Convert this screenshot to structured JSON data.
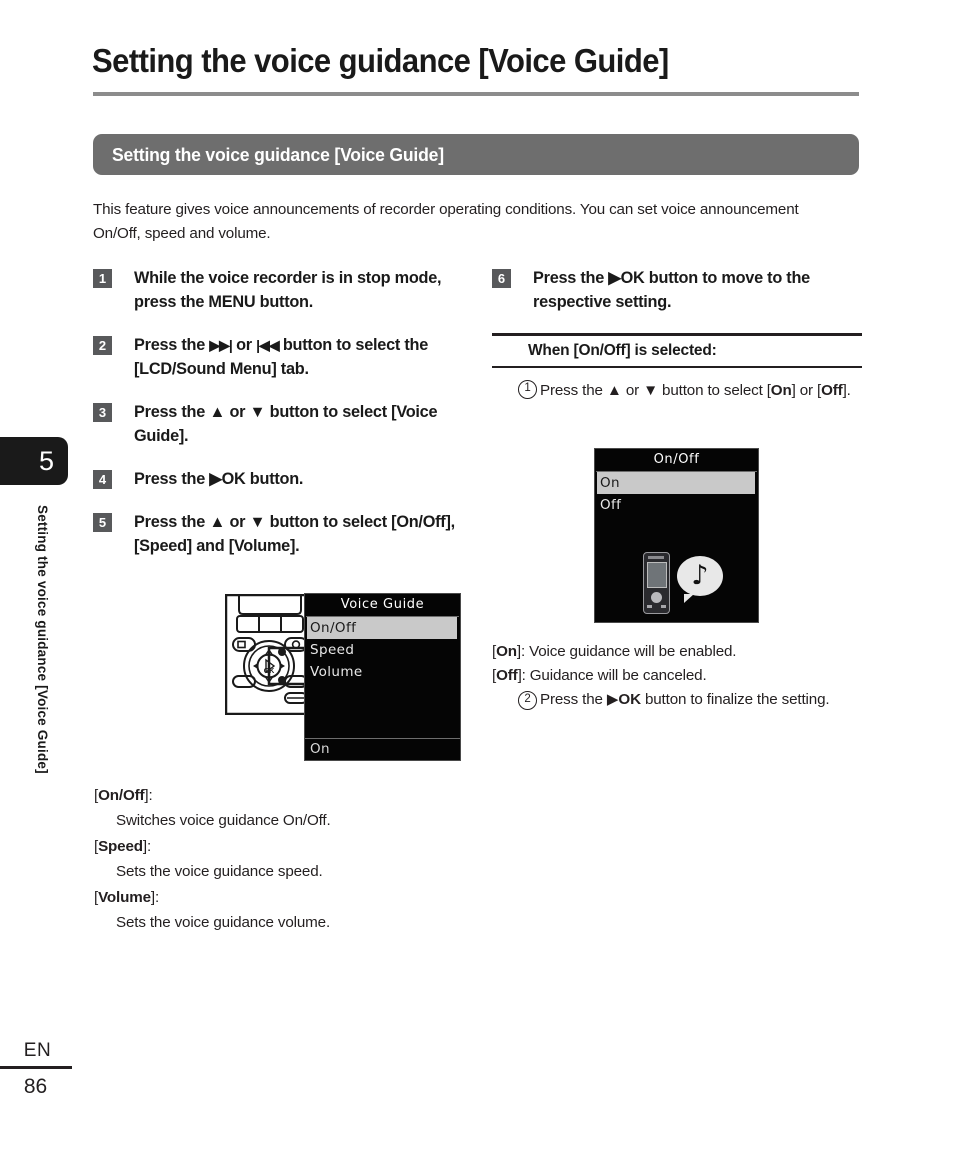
{
  "chapter": {
    "number": "5",
    "vertical_title": "Setting the voice guidance [Voice Guide]"
  },
  "footer": {
    "language": "EN",
    "page_number": "86"
  },
  "header": {
    "title": "Setting the voice guidance [Voice Guide]",
    "section_banner": "Setting the voice guidance [Voice Guide]"
  },
  "intro": "This feature gives voice announcements of recorder operating conditions. You can set voice announcement On/Off, speed and volume.",
  "steps_left": [
    {
      "num": "1",
      "text_html": "While the voice recorder is in stop mode, press the <b>MENU</b> button."
    },
    {
      "num": "2",
      "text_html": "Press the <span class=\"gly\">▶▶|</span> or <span class=\"gly\">|◀◀</span> button to select the [<b>LCD/Sound Menu</b>] tab."
    },
    {
      "num": "3",
      "text_html": "Press the ▲ or ▼ button to select [<b>Voice Guide</b>]."
    },
    {
      "num": "4",
      "text_html": "Press the ▶<b>OK</b> button."
    },
    {
      "num": "5",
      "text_html": "Press the ▲ or ▼ button to select [<b>On/Off</b>], [<b>Speed</b>] and [<b>Volume</b>]."
    }
  ],
  "steps_right": [
    {
      "num": "6",
      "text_html": "Press the ▶<b>OK</b> button to move to the respective setting."
    }
  ],
  "when_selected": {
    "heading_html": "When [<b>On/Off</b>] is selected:",
    "substep_1_html": "Press the ▲ or ▼ button to select [<b>On</b>] or [<b>Off</b>].",
    "substep_1_num": "1",
    "substep_2_html": "Press the ▶<b>OK</b> button to finalize the setting.",
    "substep_2_num": "2",
    "on_desc_html": "[<b>On</b>]: Voice guidance will be enabled.",
    "off_desc_html": "[<b>Off</b>]: Guidance will be canceled."
  },
  "lcd_voice_guide": {
    "title": "Voice Guide",
    "items": [
      "On/Off",
      "Speed",
      "Volume"
    ],
    "selected_index": 0,
    "status_bar": "On"
  },
  "lcd_on_off": {
    "title": "On/Off",
    "items": [
      "On",
      "Off"
    ],
    "selected_index": 0,
    "icon_recorder": "recorder-icon",
    "icon_note": "♪"
  },
  "definitions": [
    {
      "term_html": "[<b>On/Off</b>]:",
      "desc": "Switches voice guidance On/Off."
    },
    {
      "term_html": "[<b>Speed</b>]:",
      "desc": "Sets the voice guidance speed."
    },
    {
      "term_html": "[<b>Volume</b>]:",
      "desc": "Sets the voice guidance volume."
    }
  ],
  "colors": {
    "banner_gray": "#6e6e6e",
    "step_badge_gray": "#58595b",
    "title_rule_gray": "#8c8c8c",
    "chapter_tab_black": "#1a1a1a",
    "lcd_background": "#050505",
    "lcd_highlight": "#c9c9c9"
  }
}
